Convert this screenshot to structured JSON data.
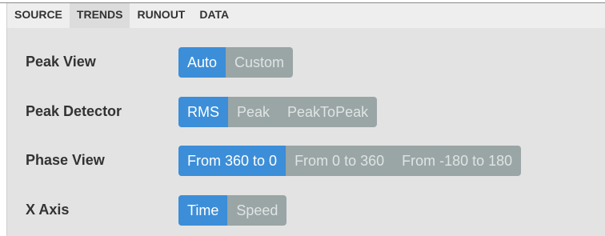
{
  "tabs": [
    {
      "label": "SOURCE",
      "active": false
    },
    {
      "label": "TRENDS",
      "active": true
    },
    {
      "label": "RUNOUT",
      "active": false
    },
    {
      "label": "DATA",
      "active": false
    }
  ],
  "settings": [
    {
      "label": "Peak View",
      "options": [
        "Auto",
        "Custom"
      ],
      "selected": "Auto"
    },
    {
      "label": "Peak Detector",
      "options": [
        "RMS",
        "Peak",
        "PeakToPeak"
      ],
      "selected": "RMS"
    },
    {
      "label": "Phase View",
      "options": [
        "From 360 to 0",
        "From 0 to 360",
        "From -180 to 180"
      ],
      "selected": "From 360 to 0"
    },
    {
      "label": "X Axis",
      "options": [
        "Time",
        "Speed"
      ],
      "selected": "Time"
    }
  ],
  "colors": {
    "selected_bg": "#3c8ed8",
    "unselected_bg": "#9aa5a5",
    "panel_bg": "#e3e3e3"
  }
}
